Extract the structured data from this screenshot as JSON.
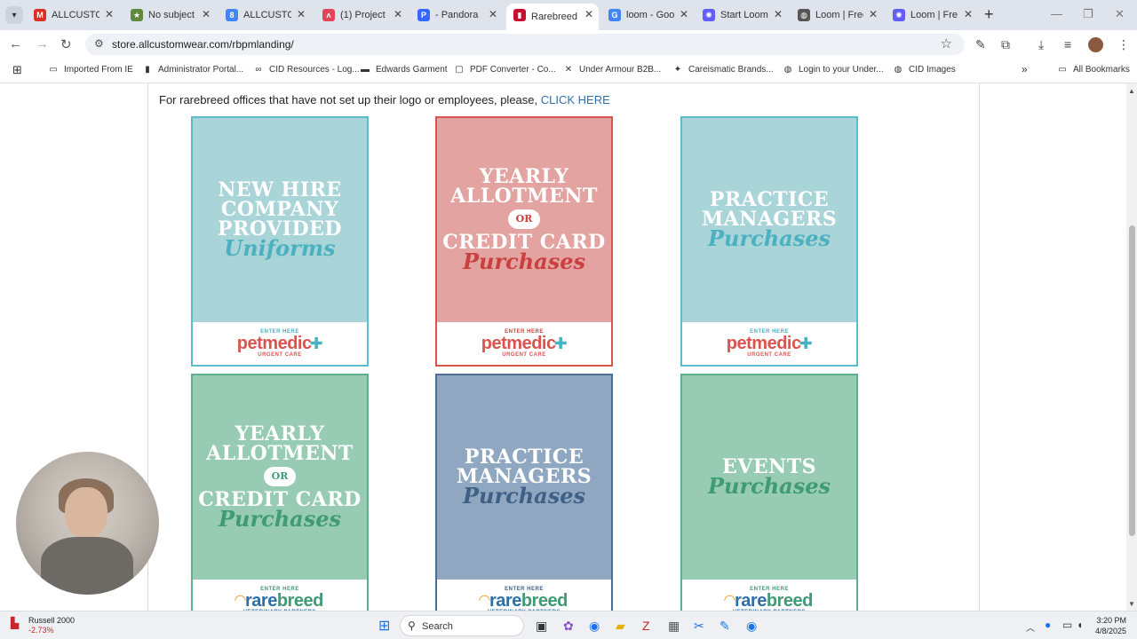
{
  "browser": {
    "tabs": [
      {
        "label": "ALLCUSTOM",
        "favicon": "gmail-icon",
        "color": "#d93025",
        "glyph": "M"
      },
      {
        "label": "No subject",
        "favicon": "star-icon",
        "color": "#5f8a3c",
        "glyph": "★"
      },
      {
        "label": "ALLCUSTOM",
        "favicon": "doc-icon",
        "color": "#4285f4",
        "glyph": "8"
      },
      {
        "label": "(1) Project",
        "favicon": "monday-icon",
        "color": "#e2445c",
        "glyph": "ʌ"
      },
      {
        "label": "- Pandora",
        "favicon": "pandora-icon",
        "color": "#3668ff",
        "glyph": "P"
      },
      {
        "label": "Rarebreed",
        "favicon": "rarebreed-icon",
        "color": "#c8102e",
        "glyph": "▮",
        "active": true
      },
      {
        "label": "loom - Goo",
        "favicon": "google-icon",
        "color": "#4285f4",
        "glyph": "G"
      },
      {
        "label": "Start Loom",
        "favicon": "loom-icon",
        "color": "#625df5",
        "glyph": "✺"
      },
      {
        "label": "Loom | Free",
        "favicon": "globe-icon",
        "color": "#555555",
        "glyph": "◍"
      },
      {
        "label": "Loom | Fre",
        "favicon": "loom-icon",
        "color": "#625df5",
        "glyph": "✺"
      }
    ],
    "url": "store.allcustomwear.com/rbpmlanding/",
    "bookmarks": [
      {
        "label": "Imported From IE",
        "icon": "folder-icon",
        "glyph": "▭"
      },
      {
        "label": "Administrator Portal...",
        "icon": "admin-icon",
        "glyph": "▮"
      },
      {
        "label": "CID Resources - Log...",
        "icon": "cid-icon",
        "glyph": "∞"
      },
      {
        "label": "Edwards Garment",
        "icon": "edwards-icon",
        "glyph": "▬"
      },
      {
        "label": "PDF Converter - Co...",
        "icon": "pdf-icon",
        "glyph": "▢"
      },
      {
        "label": "Under Armour B2B...",
        "icon": "ua-icon",
        "glyph": "✕"
      },
      {
        "label": "Careismatic Brands...",
        "icon": "careismatic-icon",
        "glyph": "✦"
      },
      {
        "label": "Login to your Under...",
        "icon": "globe-icon",
        "glyph": "◍"
      },
      {
        "label": "CID Images",
        "icon": "globe-icon",
        "glyph": "◍"
      }
    ],
    "all_bookmarks": "All Bookmarks"
  },
  "page": {
    "notice_text": "For rarebreed offices that have not set up their logo or employees, please,",
    "notice_link": "CLICK HERE",
    "cards": [
      {
        "lines": [
          "NEW HIRE",
          "COMPANY",
          "PROVIDED"
        ],
        "script": "Uniforms",
        "or": false,
        "lines2": [],
        "bg": "#a9d4d8",
        "border": "#5bbccb",
        "script_color": "#4bb0c0",
        "enter": "ENTER HERE",
        "brand_a": "pet",
        "brand_b": "medic",
        "sub": "URGENT CARE",
        "brand_type": "petmedic"
      },
      {
        "lines": [
          "YEARLY",
          "ALLOTMENT"
        ],
        "or": true,
        "or_label": "OR",
        "lines2": [
          "CREDIT CARD"
        ],
        "script": "Purchases",
        "bg": "#e3a3a1",
        "border": "#d9534f",
        "script_color": "#c9403f",
        "enter": "ENTER HERE",
        "brand_a": "pet",
        "brand_b": "medic",
        "sub": "URGENT CARE",
        "brand_type": "petmedic"
      },
      {
        "lines": [
          "PRACTICE",
          "MANAGERS"
        ],
        "script": "Purchases",
        "or": false,
        "lines2": [],
        "bg": "#a9d4d8",
        "border": "#5bbccb",
        "script_color": "#4bb0c0",
        "enter": "ENTER HERE",
        "brand_a": "pet",
        "brand_b": "medic",
        "sub": "URGENT CARE",
        "brand_type": "petmedic"
      },
      {
        "lines": [
          "YEARLY",
          "ALLOTMENT"
        ],
        "or": true,
        "or_label": "OR",
        "lines2": [
          "CREDIT CARD"
        ],
        "script": "Purchases",
        "bg": "#97cbb4",
        "border": "#5fae8c",
        "script_color": "#3f9a76",
        "enter": "ENTER HERE",
        "brand_a": "rare",
        "brand_b": "breed",
        "sub": "VETERINARY PARTNERS",
        "brand_type": "rarebreed"
      },
      {
        "lines": [
          "PRACTICE",
          "MANAGERS"
        ],
        "script": "Purchases",
        "or": false,
        "lines2": [],
        "bg": "#8fa7c1",
        "border": "#4a6e96",
        "script_color": "#3e5f86",
        "enter": "ENTER HERE",
        "brand_a": "rare",
        "brand_b": "breed",
        "sub": "VETERINARY PARTNERS",
        "brand_type": "rarebreed"
      },
      {
        "lines": [
          "EVENTS"
        ],
        "script": "Purchases",
        "or": false,
        "lines2": [],
        "bg": "#97cbb4",
        "border": "#5fae8c",
        "script_color": "#3f9a76",
        "enter": "ENTER HERE",
        "brand_a": "rare",
        "brand_b": "breed",
        "sub": "VETERINARY PARTNERS",
        "brand_type": "rarebreed"
      }
    ]
  },
  "taskbar": {
    "stock_name": "Russell 2000",
    "stock_change": "-2.73%",
    "search_label": "Search",
    "time": "3:20 PM",
    "date": "4/8/2025"
  }
}
